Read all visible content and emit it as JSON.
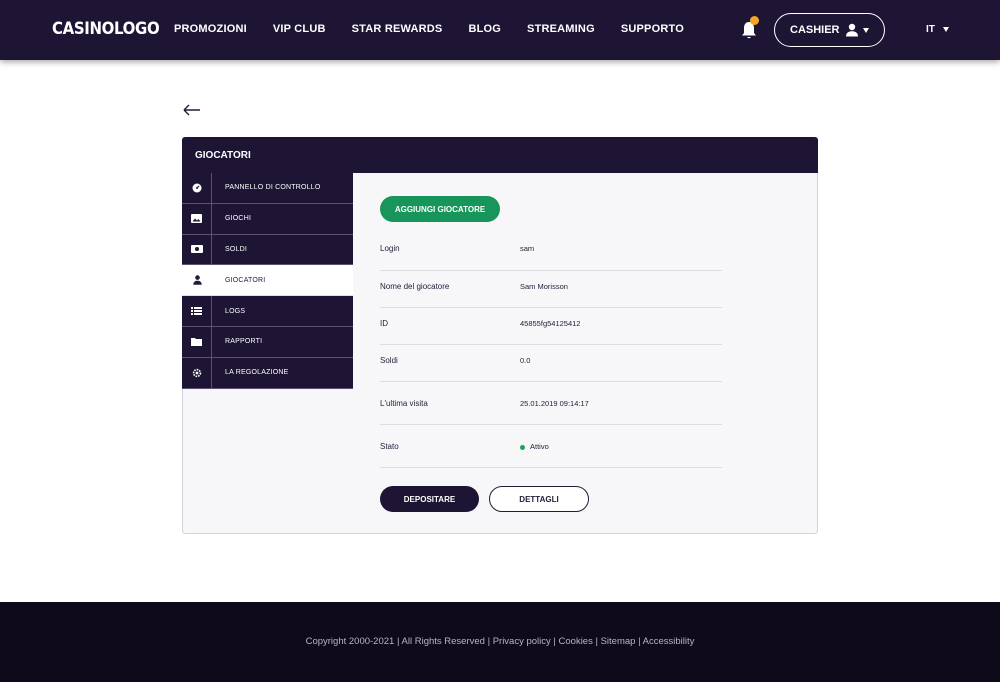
{
  "header": {
    "logo": "CASINOLOGO",
    "nav": [
      "PROMOZIONI",
      "VIP CLUB",
      "STAR REWARDS",
      "BLOG",
      "STREAMING",
      "SUPPORTO"
    ],
    "cashier_label": "CASHIER",
    "language": "IT"
  },
  "panel": {
    "title": "GIOCATORI",
    "sidebar": [
      {
        "label": "PANNELLO DI CONTROLLO",
        "icon": "dashboard-icon"
      },
      {
        "label": "GIOCHI",
        "icon": "image-icon"
      },
      {
        "label": "SOLDI",
        "icon": "money-icon"
      },
      {
        "label": "GIOCATORI",
        "icon": "user-icon"
      },
      {
        "label": "LOGS",
        "icon": "list-icon"
      },
      {
        "label": "RAPPORTI",
        "icon": "folder-icon"
      },
      {
        "label": "LA REGOLAZIONE",
        "icon": "gear-icon"
      }
    ],
    "active_item": "GIOCATORI",
    "add_button": "AGGIUNGI GIOCATORE",
    "fields": [
      {
        "label": "Login",
        "value": "sam"
      },
      {
        "label": "Nome del giocatore",
        "value": "Sam Morisson"
      },
      {
        "label": "ID",
        "value": "45855fg54125412"
      },
      {
        "label": "Soldi",
        "value": "0.0"
      },
      {
        "label": "L'ultima visita",
        "value": "25.01.2019 09:14:17"
      },
      {
        "label": "Stato",
        "value": "Attivo"
      }
    ],
    "deposit_button": "DEPOSITARE",
    "details_button": "DETTAGLI"
  },
  "footer": {
    "text": "Copyright 2000-2021 | All Rights Reserved | Privacy policy | Cookies | Sitemap | Accessibility"
  },
  "colors": {
    "header_bg": "#1e1535",
    "accent_green": "#18955a",
    "notification_dot": "#f5a623",
    "footer_bg": "#0e0a1a"
  }
}
